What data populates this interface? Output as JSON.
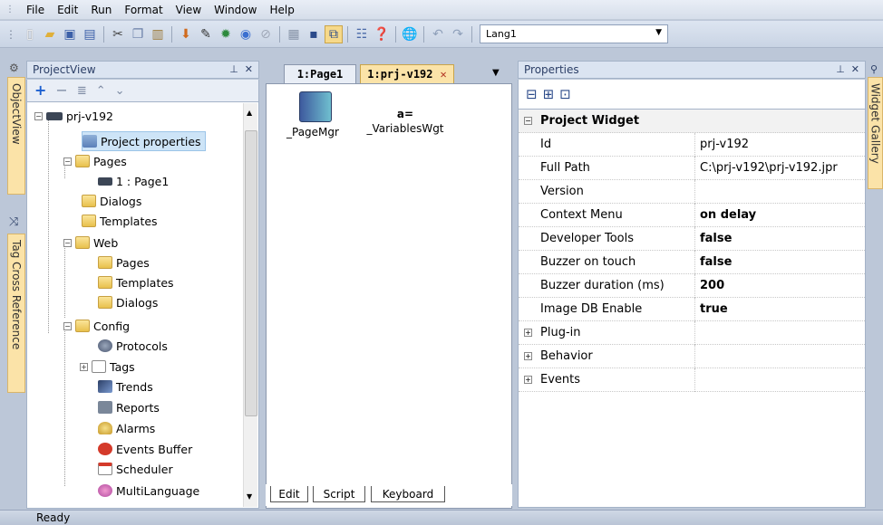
{
  "menu": {
    "items": [
      "File",
      "Edit",
      "Run",
      "Format",
      "View",
      "Window",
      "Help"
    ]
  },
  "toolbar": {
    "language": "Lang1",
    "icons": [
      "new-page-icon",
      "open-icon",
      "save-icon",
      "save-all-icon",
      "cut-icon",
      "copy-icon",
      "paste-icon",
      "download-icon",
      "eyedropper-icon",
      "gear-icon",
      "play-icon",
      "stop-icon",
      "grid-icon",
      "snap-icon",
      "align-icon",
      "properties-icon",
      "help-icon",
      "globe-icon",
      "undo-icon",
      "redo-icon"
    ]
  },
  "left_tabs": {
    "object_view": "ObjectView",
    "tag_xref": "Tag Cross Reference"
  },
  "right_tabs": {
    "widget_gallery": "Widget Gallery"
  },
  "project_view": {
    "title": "ProjectView",
    "nodes": [
      {
        "label": "prj-v192"
      },
      {
        "label": "Project properties"
      },
      {
        "label": "Pages"
      },
      {
        "label": "1 : Page1"
      },
      {
        "label": "Dialogs"
      },
      {
        "label": "Templates"
      },
      {
        "label": "Web"
      },
      {
        "label": "Pages"
      },
      {
        "label": "Templates"
      },
      {
        "label": "Dialogs"
      },
      {
        "label": "Config"
      },
      {
        "label": "Protocols"
      },
      {
        "label": "Tags"
      },
      {
        "label": "Trends"
      },
      {
        "label": "Reports"
      },
      {
        "label": "Alarms"
      },
      {
        "label": "Events Buffer"
      },
      {
        "label": "Scheduler"
      },
      {
        "label": "MultiLanguage"
      }
    ]
  },
  "editor": {
    "tabs": [
      "1:Page1",
      "1:prj-v192"
    ],
    "widgets": [
      {
        "label": "_PageMgr"
      },
      {
        "label": "_VariablesWgt",
        "glyph": "a="
      }
    ],
    "bottom_tabs": [
      "Edit",
      "Script",
      "Keyboard"
    ]
  },
  "properties": {
    "title": "Properties",
    "group": "Project Widget",
    "rows": [
      {
        "key": "Id",
        "value": "prj-v192",
        "bold": false
      },
      {
        "key": "Full Path",
        "value": "C:\\prj-v192\\prj-v192.jpr",
        "bold": false
      },
      {
        "key": "Version",
        "value": "",
        "bold": false
      },
      {
        "key": "Context Menu",
        "value": "on delay",
        "bold": true
      },
      {
        "key": "Developer Tools",
        "value": "false",
        "bold": true
      },
      {
        "key": "Buzzer on touch",
        "value": "false",
        "bold": true
      },
      {
        "key": "Buzzer duration (ms)",
        "value": "200",
        "bold": true
      },
      {
        "key": "Image DB Enable",
        "value": "true",
        "bold": true
      }
    ],
    "collapsed": [
      "Plug-in",
      "Behavior",
      "Events"
    ]
  },
  "status": {
    "text": "Ready"
  },
  "colors": {
    "accent": "#fbe3a8",
    "header": "#dbe4f1",
    "chrome": "#bcc7d8"
  }
}
